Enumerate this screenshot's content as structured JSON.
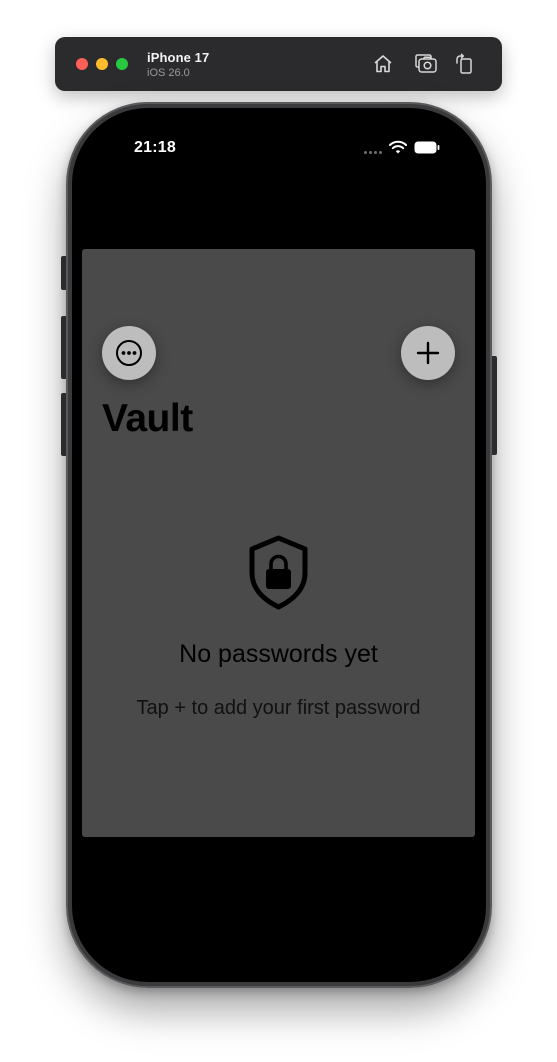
{
  "simulator": {
    "device_name": "iPhone 17",
    "os_version": "iOS 26.0",
    "toolbar_icons": [
      "home-icon",
      "screenshot-icon",
      "rotate-icon"
    ]
  },
  "status_bar": {
    "time": "21:18",
    "icons": [
      "cellular-icon",
      "wifi-icon",
      "battery-icon"
    ]
  },
  "app": {
    "title": "Vault",
    "toolbar": {
      "left_button_icon": "ellipsis-circle-icon",
      "right_button_icon": "plus-icon"
    },
    "empty_state": {
      "icon": "lock-shield-icon",
      "title": "No passwords yet",
      "subtitle": "Tap + to add your first password"
    }
  },
  "colors": {
    "sheet_background": "#4a4a4a",
    "button_background": "#bdbdbd",
    "screen_background": "#000000",
    "toolbar_background": "#2b2b2d"
  }
}
